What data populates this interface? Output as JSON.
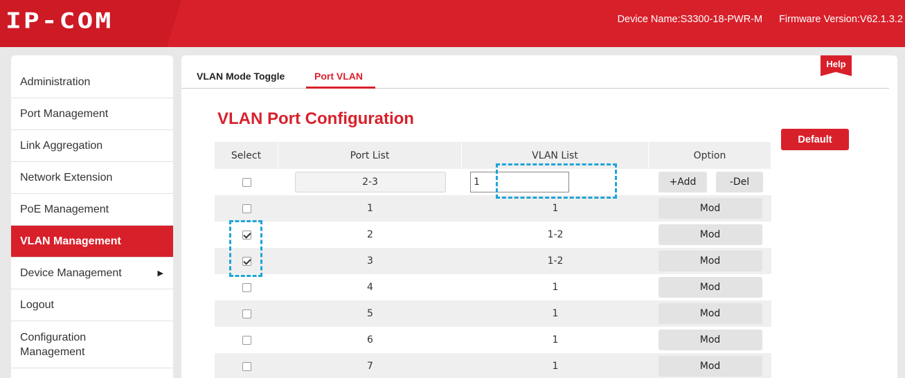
{
  "header": {
    "logo": "IP-COM",
    "device_name": "Device Name:S3300-18-PWR-M",
    "firmware_version": "Firmware Version:V62.1.3.2",
    "brand_color": "#d8202b"
  },
  "sidebar": {
    "items": [
      {
        "label": "Administration"
      },
      {
        "label": "Port Management"
      },
      {
        "label": "Link Aggregation"
      },
      {
        "label": "Network Extension"
      },
      {
        "label": "PoE Management"
      },
      {
        "label": "VLAN Management",
        "active": true
      },
      {
        "label": "Device Management",
        "has_submenu": true,
        "submenu_icon": "triangle-right-icon"
      },
      {
        "label": "Logout"
      },
      {
        "label": "Configuration Management"
      }
    ]
  },
  "tabs": [
    {
      "label": "VLAN Mode Toggle"
    },
    {
      "label": "Port VLAN",
      "active": true
    }
  ],
  "help_label": "Help",
  "title": "VLAN Port Configuration",
  "default_label": "Default",
  "table": {
    "headers": [
      "Select",
      "Port List",
      "VLAN List",
      "Option"
    ],
    "input_row": {
      "checked": false,
      "port_list": "2-3",
      "vlan_list": "1",
      "add_label": "+Add",
      "del_label": "-Del"
    },
    "mod_label": "Mod",
    "rows": [
      {
        "port": "1",
        "vlan": "1",
        "checked": false
      },
      {
        "port": "2",
        "vlan": "1-2",
        "checked": true
      },
      {
        "port": "3",
        "vlan": "1-2",
        "checked": true
      },
      {
        "port": "4",
        "vlan": "1",
        "checked": false
      },
      {
        "port": "5",
        "vlan": "1",
        "checked": false
      },
      {
        "port": "6",
        "vlan": "1",
        "checked": false
      },
      {
        "port": "7",
        "vlan": "1",
        "checked": false
      }
    ]
  },
  "highlight_color": "#1ea4d8"
}
